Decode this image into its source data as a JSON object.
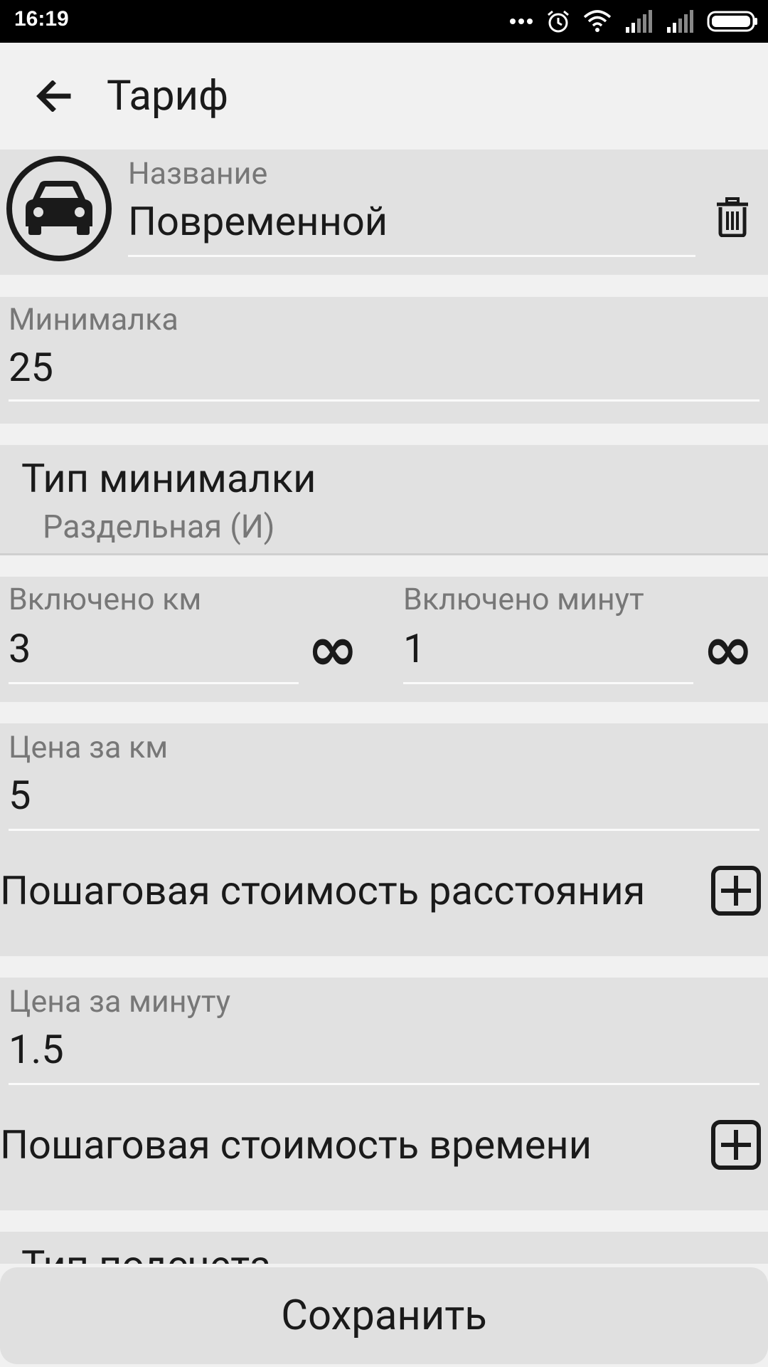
{
  "status_bar": {
    "time": "16:19",
    "icons": [
      "more-dots-icon",
      "alarm-icon",
      "wifi-icon",
      "signal-icon",
      "signal-icon-2",
      "battery-icon"
    ]
  },
  "app_bar": {
    "title": "Тариф",
    "back_icon": "arrow-back-icon"
  },
  "name_field": {
    "label": "Название",
    "value": "Повременной",
    "icon": "car-icon",
    "delete_icon": "trash-icon"
  },
  "min_field": {
    "label": "Минималка",
    "value": "25"
  },
  "min_type": {
    "title": "Тип минималки",
    "value": "Раздельная (И)"
  },
  "included_km": {
    "label": "Включено км",
    "value": "3",
    "infinity": "∞"
  },
  "included_min": {
    "label": "Включено минут",
    "value": "1",
    "infinity": "∞"
  },
  "price_km": {
    "label": "Цена за км",
    "value": "5"
  },
  "step_distance": {
    "label": "Пошаговая стоимость расстояния",
    "icon": "plus-box-icon"
  },
  "price_min": {
    "label": "Цена за минуту",
    "value": "1.5"
  },
  "step_time": {
    "label": "Пошаговая стоимость времени",
    "icon": "plus-box-icon"
  },
  "calc_type": {
    "title": "Тип подсчета"
  },
  "save_label": "Сохранить"
}
